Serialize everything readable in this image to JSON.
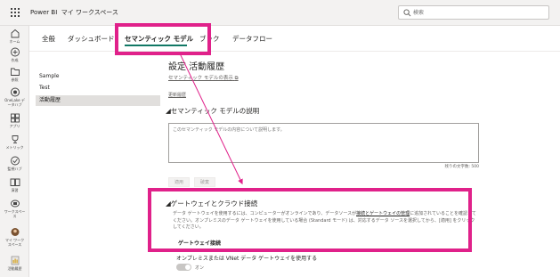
{
  "app": {
    "brand": "Power BI",
    "workspace": "マイ ワークスペース"
  },
  "search": {
    "placeholder": "検索"
  },
  "rail": [
    {
      "icon": "home-icon",
      "label": "ホーム"
    },
    {
      "icon": "create-icon",
      "label": "作成"
    },
    {
      "icon": "browse-icon",
      "label": "参照"
    },
    {
      "icon": "onelake-data-hub-icon",
      "label": "OneLake デ\nータハブ"
    },
    {
      "icon": "apps-icon",
      "label": "アプリ"
    },
    {
      "icon": "metrics-icon",
      "label": "メトリック"
    },
    {
      "icon": "monitoring-hub-icon",
      "label": "監視ハブ"
    },
    {
      "icon": "learn-icon",
      "label": "演習"
    },
    {
      "icon": "workspaces-icon",
      "label": "ワークスペー\nス"
    },
    {
      "icon": "my-workspace-icon",
      "label": "マイ ワーク\nスペース"
    },
    {
      "icon": "activity-history-icon",
      "label": "活動履歴"
    }
  ],
  "tabs": [
    "全般",
    "ダッシュボード",
    "セマンティック モデル",
    "ブック",
    "データフロー"
  ],
  "side_nav": [
    "Sample",
    "Test",
    "活動履歴"
  ],
  "main": {
    "title": "設定 活動履歴",
    "view_link": "セマンティック モデルの表示",
    "refresh_link": "更新履歴",
    "desc_heading": "セマンティック モデルの説明",
    "desc_placeholder": "このセマンティック モデルの内容について説明します。",
    "char_count": "残りの文字数: 500",
    "apply_label": "適用",
    "discard_label": "破棄",
    "gateway_heading": "ゲートウェイとクラウド接続",
    "gateway_desc_1": "データ ゲートウェイを使用するには、コンピューターがオンラインであり、データソースが",
    "gateway_desc_link": "接続とゲートウェイの管理",
    "gateway_desc_2": "に追加されていることを確認してください。オンプレミスのデータ ゲートウェイを使用している場合 (Standard モード) は、対応するデータ ソースを選択してから、[適用] をクリックしてください。",
    "gateway_conn_heading": "ゲートウェイ接続",
    "gateway_checkbox_label": "オンプレミスまたは VNet データ ゲートウェイを使用する",
    "toggle_label": "オン"
  },
  "colors": {
    "annotation": "#e0218a",
    "accent": "#117865"
  }
}
